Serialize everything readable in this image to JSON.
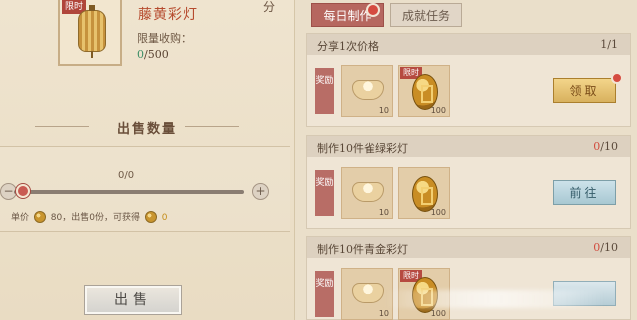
{
  "item": {
    "limited_tag": "限时",
    "name": "藤黄彩灯",
    "limit_label": "限量收购：",
    "limit_current": "0",
    "limit_total": "/500",
    "corner_glyph": "分"
  },
  "sale": {
    "quantity_title": "出售数量",
    "count_display": "0/0",
    "price_prefix": "单价",
    "price_value": "80",
    "sold_text": "，出售0份，可获得",
    "gain_value": "0",
    "sell_label": "出售"
  },
  "tabs": {
    "daily_label": "每日制作",
    "achievement_label": "成就任务"
  },
  "tasks": [
    {
      "name": "分享1次价格",
      "progress": "1/1",
      "reward_tag": "奖励",
      "rewards": [
        {
          "quantity": "10",
          "icon": "silver-ingot"
        },
        {
          "quantity": "100",
          "icon": "gold-coin",
          "limited_tag": "限时"
        }
      ],
      "button_label": "领取"
    },
    {
      "name": "制作10件雀绿彩灯",
      "progress_prefix": "0",
      "progress_suffix": "/10",
      "reward_tag": "奖励",
      "rewards": [
        {
          "quantity": "10",
          "icon": "silver-ingot"
        },
        {
          "quantity": "100",
          "icon": "gold-coin"
        }
      ],
      "button_label": "前往"
    },
    {
      "name": "制作10件青金彩灯",
      "progress_prefix": "0",
      "progress_suffix": "/10",
      "reward_tag": "奖励",
      "rewards": [
        {
          "quantity": "10",
          "icon": "silver-ingot"
        },
        {
          "quantity": "100",
          "icon": "gold-coin",
          "limited_tag": "限时"
        }
      ],
      "button_label": ""
    }
  ],
  "colors": {
    "accent_red": "#d54b40",
    "task_tab": "#b6675f",
    "claim_gold": "#d8b15e",
    "go_blue": "#a8c8d2"
  }
}
